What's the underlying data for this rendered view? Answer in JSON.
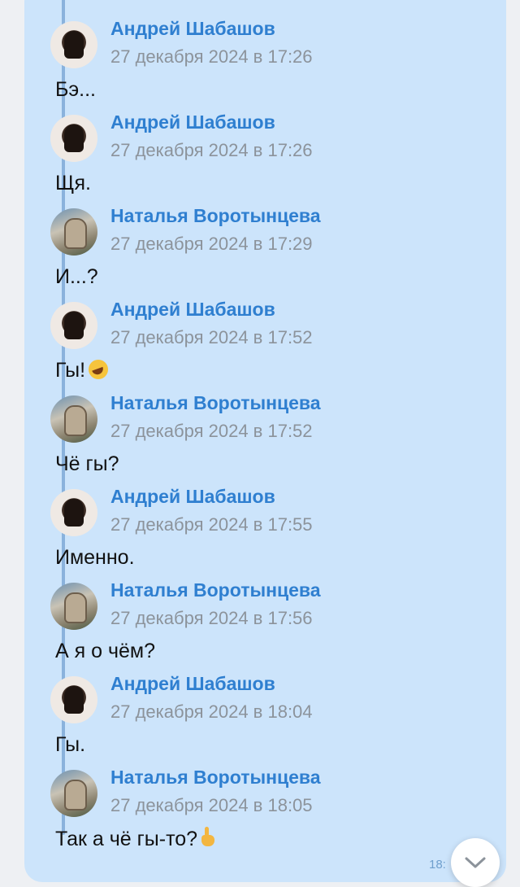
{
  "messages": [
    {
      "author": "Андрей Шабашов",
      "time": "27 декабря 2024 в 17:26",
      "text": "Бэ...",
      "avatar": "andrey-avatar",
      "emoji": ""
    },
    {
      "author": "Андрей Шабашов",
      "time": "27 декабря 2024 в 17:26",
      "text": "Щя.",
      "avatar": "andrey-avatar",
      "emoji": ""
    },
    {
      "author": "Наталья Воротынцева",
      "time": "27 декабря 2024 в 17:29",
      "text": "И...?",
      "avatar": "natalia-avatar",
      "emoji": ""
    },
    {
      "author": "Андрей Шабашов",
      "time": "27 декабря 2024 в 17:52",
      "text": "Гы!",
      "avatar": "andrey-avatar",
      "emoji": "rolling-laughing-emoji"
    },
    {
      "author": "Наталья Воротынцева",
      "time": "27 декабря 2024 в 17:52",
      "text": "Чё гы?",
      "avatar": "natalia-avatar",
      "emoji": ""
    },
    {
      "author": "Андрей Шабашов",
      "time": "27 декабря 2024 в 17:55",
      "text": "Именно.",
      "avatar": "andrey-avatar",
      "emoji": ""
    },
    {
      "author": "Наталья Воротынцева",
      "time": "27 декабря 2024 в 17:56",
      "text": "А я о чём?",
      "avatar": "natalia-avatar",
      "emoji": ""
    },
    {
      "author": "Андрей Шабашов",
      "time": "27 декабря 2024 в 18:04",
      "text": "Гы.",
      "avatar": "andrey-avatar",
      "emoji": ""
    },
    {
      "author": "Наталья Воротынцева",
      "time": "27 декабря 2024 в 18:05",
      "text": "Так а чё гы-то?",
      "avatar": "natalia-avatar",
      "emoji": "pointing-up-emoji"
    }
  ],
  "bubble_time": "18:",
  "scroll_button": {
    "icon": "chevron-down-icon"
  },
  "colors": {
    "bubble": "#cce4fb",
    "author": "#2f7fd0",
    "time": "#8c939b",
    "quote_bar": "#8ab2dc"
  }
}
